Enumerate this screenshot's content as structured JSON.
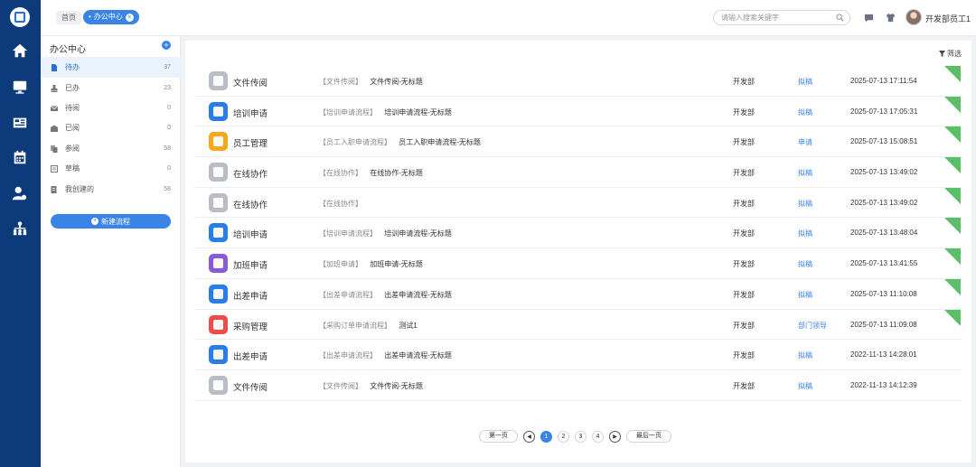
{
  "header": {
    "home_label": "首页",
    "active_tab_label": "办公中心",
    "search_placeholder": "请输入搜索关键字",
    "username": "开发部员工1"
  },
  "sidebar": {
    "title": "办公中心",
    "items": [
      {
        "label": "待办",
        "count": "37",
        "icon": "doc-icon"
      },
      {
        "label": "已办",
        "count": "23",
        "icon": "stamp-icon"
      },
      {
        "label": "待阅",
        "count": "0",
        "icon": "mail-icon"
      },
      {
        "label": "已阅",
        "count": "0",
        "icon": "mail-open-icon"
      },
      {
        "label": "参阅",
        "count": "58",
        "icon": "copy-icon"
      },
      {
        "label": "草稿",
        "count": "0",
        "icon": "draft-icon"
      },
      {
        "label": "我创建的",
        "count": "58",
        "icon": "created-icon"
      }
    ],
    "new_button_label": "新建流程"
  },
  "main": {
    "filter_label": "筛选",
    "rows": [
      {
        "app": "文件传阅",
        "color": "#b9bec6",
        "flow": "【文件传阅】",
        "title": "文件传阅-无标题",
        "dept": "开发部",
        "status": "拟稿",
        "time": "2025-07-13 17:11:54",
        "new": true
      },
      {
        "app": "培训申请",
        "color": "#2a7de8",
        "flow": "【培训申请流程】",
        "title": "培训申请流程-无标题",
        "dept": "开发部",
        "status": "拟稿",
        "time": "2025-07-13 17:05:31",
        "new": true
      },
      {
        "app": "员工管理",
        "color": "#f5a81c",
        "flow": "【员工入职申请流程】",
        "title": "员工入职申请流程-无标题",
        "dept": "开发部",
        "status": "申请",
        "time": "2025-07-13 15:08:51",
        "new": true
      },
      {
        "app": "在线协作",
        "color": "#b9bec6",
        "flow": "【在线协作】",
        "title": "在线协作-无标题",
        "dept": "开发部",
        "status": "拟稿",
        "time": "2025-07-13 13:49:02",
        "new": true
      },
      {
        "app": "在线协作",
        "color": "#b9bec6",
        "flow": "【在线协作】",
        "title": "",
        "dept": "开发部",
        "status": "拟稿",
        "time": "2025-07-13 13:49:02",
        "new": true
      },
      {
        "app": "培训申请",
        "color": "#2a7de8",
        "flow": "【培训申请流程】",
        "title": "培训申请流程-无标题",
        "dept": "开发部",
        "status": "拟稿",
        "time": "2025-07-13 13:48:04",
        "new": true
      },
      {
        "app": "加班申请",
        "color": "#8a5ad6",
        "flow": "【加班申请】",
        "title": "加班申请-无标题",
        "dept": "开发部",
        "status": "拟稿",
        "time": "2025-07-13 13:41:55",
        "new": true
      },
      {
        "app": "出差申请",
        "color": "#2a7de8",
        "flow": "【出差申请流程】",
        "title": "出差申请流程-无标题",
        "dept": "开发部",
        "status": "拟稿",
        "time": "2025-07-13 11:10:08",
        "new": true
      },
      {
        "app": "采购管理",
        "color": "#ee4b4b",
        "flow": "【采购订单申请流程】",
        "title": "测试1",
        "dept": "开发部",
        "status": "部门领导",
        "time": "2025-07-13 11:09:08",
        "new": true
      },
      {
        "app": "出差申请",
        "color": "#2a7de8",
        "flow": "【出差申请流程】",
        "title": "出差申请流程-无标题",
        "dept": "开发部",
        "status": "拟稿",
        "time": "2022-11-13 14:28:01",
        "new": false
      },
      {
        "app": "文件传阅",
        "color": "#b9bec6",
        "flow": "【文件传阅】",
        "title": "文件传阅-无标题",
        "dept": "开发部",
        "status": "拟稿",
        "time": "2022-11-13 14:12:39",
        "new": false
      }
    ]
  },
  "pagination": {
    "first_label": "第一页",
    "last_label": "最后一页",
    "pages": [
      "1",
      "2",
      "3",
      "4"
    ],
    "current": "1"
  }
}
